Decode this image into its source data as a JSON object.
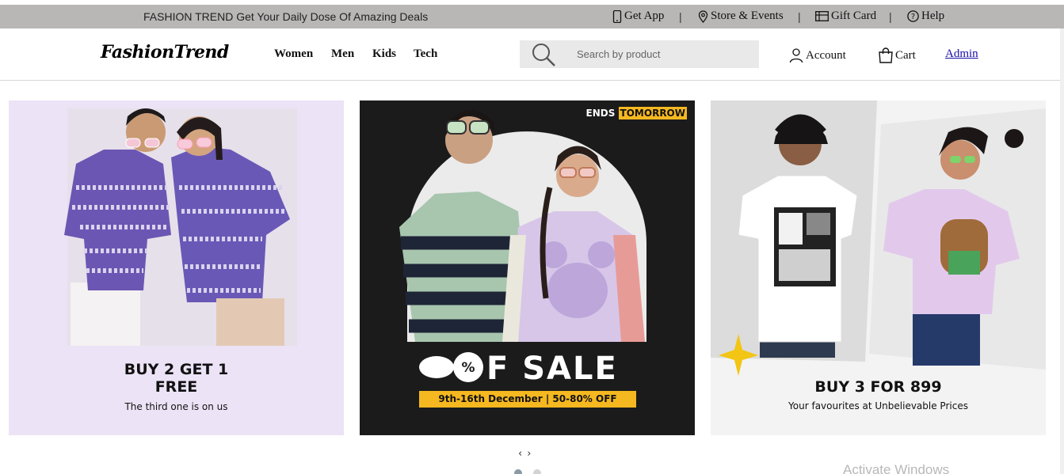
{
  "topbar": {
    "promo": "FASHION TREND Get Your Daily Dose Of Amazing Deals",
    "links": {
      "get_app": "Get App",
      "store_events": "Store & Events",
      "gift_card": "Gift Card",
      "help": "Help"
    },
    "separator": "|"
  },
  "header": {
    "logo": "FashionTrend",
    "nav": {
      "women": "Women",
      "men": "Men",
      "kids": "Kids",
      "tech": "Tech"
    },
    "search": {
      "placeholder": "Search by product",
      "value": ""
    },
    "account": "Account",
    "cart": "Cart",
    "admin": "Admin"
  },
  "banners": [
    {
      "title_line1": "BUY 2 GET 1",
      "title_line2": "FREE",
      "subtitle": "The third one is on us",
      "bg_color": "#ece3f6"
    },
    {
      "badge_prefix": "ENDS",
      "badge_highlight": "TOMORROW",
      "headline": "OOF SALE",
      "date_text": "9th-16th December  |  50-80% OFF",
      "bg_color": "#1b1b1b",
      "accent_color": "#f5b820"
    },
    {
      "title": "BUY 3 FOR 899",
      "subtitle": "Your favourites at Unbelievable Prices",
      "bg_color": "#f3f3f3"
    }
  ],
  "carousel": {
    "prev": "‹",
    "next": "›",
    "active_index": 0,
    "count": 2
  },
  "watermark": "Activate Windows",
  "colors": {
    "topbar": "#b9b6b6",
    "link": "#1a0dab",
    "sale_yellow": "#f5b820"
  }
}
